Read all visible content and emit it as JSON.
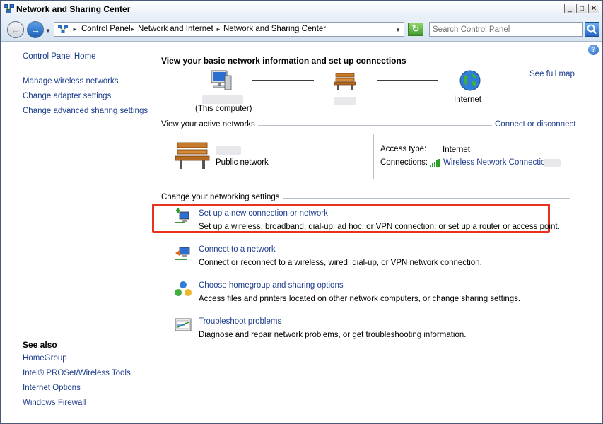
{
  "window": {
    "title": "Network and Sharing Center",
    "controls": {
      "minimize": "_",
      "maximize": "□",
      "close": "✕"
    }
  },
  "address": {
    "crumbs": [
      "Control Panel",
      "Network and Internet",
      "Network and Sharing Center"
    ],
    "search_placeholder": "Search Control Panel"
  },
  "sidebar": {
    "home": "Control Panel Home",
    "items": [
      {
        "label": "Manage wireless networks"
      },
      {
        "label": "Change adapter settings"
      },
      {
        "label": "Change advanced sharing settings"
      }
    ],
    "see_also_title": "See also",
    "see_also": [
      {
        "label": "HomeGroup"
      },
      {
        "label": "Intel® PROSet/Wireless Tools"
      },
      {
        "label": "Internet Options"
      },
      {
        "label": "Windows Firewall"
      }
    ]
  },
  "main": {
    "title": "View your basic network information and set up connections",
    "see_full_map": "See full map",
    "map": {
      "computer_label": "(This computer)",
      "internet_label": "Internet"
    },
    "active_networks": {
      "heading": "View your active networks",
      "connect_link": "Connect or disconnect",
      "network_type": "Public network",
      "access_type_label": "Access type:",
      "access_type_value": "Internet",
      "connections_label": "Connections:",
      "connection_value": "Wireless Network Connection"
    },
    "settings": {
      "heading": "Change your networking settings",
      "tasks": [
        {
          "title": "Set up a new connection or network",
          "desc": "Set up a wireless, broadband, dial-up, ad hoc, or VPN connection; or set up a router or access point.",
          "icon": "new-connection-icon"
        },
        {
          "title": "Connect to a network",
          "desc": "Connect or reconnect to a wireless, wired, dial-up, or VPN network connection.",
          "icon": "connect-network-icon"
        },
        {
          "title": "Choose homegroup and sharing options",
          "desc": "Access files and printers located on other network computers, or change sharing settings.",
          "icon": "homegroup-icon"
        },
        {
          "title": "Troubleshoot problems",
          "desc": "Diagnose and repair network problems, or get troubleshooting information.",
          "icon": "troubleshoot-icon"
        }
      ]
    }
  },
  "colors": {
    "link": "#1e3e8c",
    "highlight_box": "#e8311f"
  }
}
